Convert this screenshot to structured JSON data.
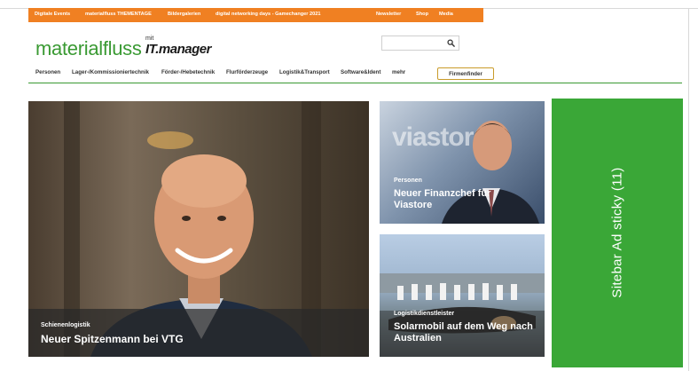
{
  "topbar": {
    "links": [
      "Digitale Events",
      "materialfluss THEMENTAGE",
      "Bildergalerien",
      "digital networking days - Gamechanger 2021",
      "Newsletter",
      "Shop",
      "Media"
    ]
  },
  "logo": {
    "main": "materialfluss",
    "mit": "mit",
    "it": "IT.manager"
  },
  "search": {
    "value": "",
    "placeholder": ""
  },
  "nav": {
    "items": [
      "Personen",
      "Lager-/Kommissioniertechnik",
      "Förder-/Hebetechnik",
      "Flurförderzeuge",
      "Logistik&Transport",
      "Software&Ident",
      "mehr"
    ],
    "firmenfinder": "Firmenfinder"
  },
  "articles": [
    {
      "kicker": "Schienenlogistik",
      "title": "Neuer Spitzenmann bei VTG"
    },
    {
      "kicker": "Personen",
      "title": "Neuer Finanzchef für Viastore",
      "brand": "viastore"
    },
    {
      "kicker": "Logistikdienstleister",
      "title": "Solarmobil auf dem Weg nach Australien"
    }
  ],
  "ad": {
    "label": "Sitebar Ad sticky (11)"
  },
  "colors": {
    "orange": "#f08022",
    "green": "#3a9a33",
    "ad_green": "#3aa737"
  }
}
